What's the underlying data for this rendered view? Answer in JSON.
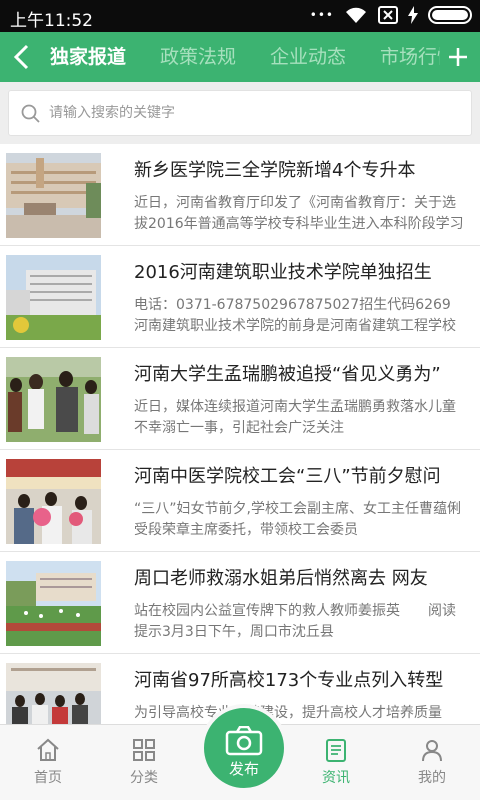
{
  "status": {
    "time": "上午11:52"
  },
  "nav": {
    "tabs": [
      "独家报道",
      "政策法规",
      "企业动态",
      "市场行情"
    ],
    "active_tab": 0
  },
  "search": {
    "placeholder": "请输入搜索的关键字"
  },
  "articles": [
    {
      "title": "新乡医学院三全学院新增4个专升本",
      "desc": "近日，河南省教育厅印发了《河南省教育厅：关于选拔2016年普通高等学校专科毕业生进入本科阶段学习"
    },
    {
      "title": "2016河南建筑职业技术学院单独招生",
      "desc": "电话：0371-6787502967875027招生代码6269　　河南建筑职业技术学院的前身是河南省建筑工程学校"
    },
    {
      "title": "河南大学生孟瑞鹏被追授“省见义勇为”",
      "desc": "近日，媒体连续报道河南大学生孟瑞鹏勇救落水儿童不幸溺亡一事，引起社会广泛关注"
    },
    {
      "title": "河南中医学院校工会“三八”节前夕慰问",
      "desc": "“三八”妇女节前夕,学校工会副主席、女工主任曹蕴俐受段荣章主席委托，带领校工会委员"
    },
    {
      "title": "周口老师救溺水姐弟后悄然离去 网友",
      "desc": "站在校园内公益宣传牌下的救人教师姜振英　　阅读提示3月3日下午，周口市沈丘县"
    },
    {
      "title": "河南省97所高校173个专业点列入转型",
      "desc": "为引导高校专业改革建设，提升高校人才培养质量"
    }
  ],
  "tabbar": {
    "home": "首页",
    "category": "分类",
    "publish": "发布",
    "news": "资讯",
    "mine": "我的"
  },
  "colors": {
    "accent": "#3cb371",
    "status_bar": "#0c0c0c"
  }
}
